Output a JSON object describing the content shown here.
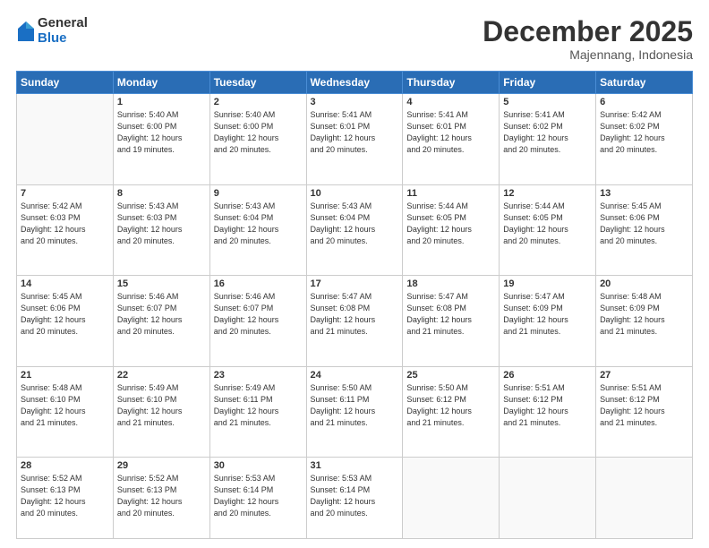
{
  "logo": {
    "general": "General",
    "blue": "Blue"
  },
  "header": {
    "month": "December 2025",
    "location": "Majennang, Indonesia"
  },
  "weekdays": [
    "Sunday",
    "Monday",
    "Tuesday",
    "Wednesday",
    "Thursday",
    "Friday",
    "Saturday"
  ],
  "weeks": [
    [
      {
        "day": "",
        "info": ""
      },
      {
        "day": "1",
        "info": "Sunrise: 5:40 AM\nSunset: 6:00 PM\nDaylight: 12 hours\nand 19 minutes."
      },
      {
        "day": "2",
        "info": "Sunrise: 5:40 AM\nSunset: 6:00 PM\nDaylight: 12 hours\nand 20 minutes."
      },
      {
        "day": "3",
        "info": "Sunrise: 5:41 AM\nSunset: 6:01 PM\nDaylight: 12 hours\nand 20 minutes."
      },
      {
        "day": "4",
        "info": "Sunrise: 5:41 AM\nSunset: 6:01 PM\nDaylight: 12 hours\nand 20 minutes."
      },
      {
        "day": "5",
        "info": "Sunrise: 5:41 AM\nSunset: 6:02 PM\nDaylight: 12 hours\nand 20 minutes."
      },
      {
        "day": "6",
        "info": "Sunrise: 5:42 AM\nSunset: 6:02 PM\nDaylight: 12 hours\nand 20 minutes."
      }
    ],
    [
      {
        "day": "7",
        "info": "Sunrise: 5:42 AM\nSunset: 6:03 PM\nDaylight: 12 hours\nand 20 minutes."
      },
      {
        "day": "8",
        "info": "Sunrise: 5:43 AM\nSunset: 6:03 PM\nDaylight: 12 hours\nand 20 minutes."
      },
      {
        "day": "9",
        "info": "Sunrise: 5:43 AM\nSunset: 6:04 PM\nDaylight: 12 hours\nand 20 minutes."
      },
      {
        "day": "10",
        "info": "Sunrise: 5:43 AM\nSunset: 6:04 PM\nDaylight: 12 hours\nand 20 minutes."
      },
      {
        "day": "11",
        "info": "Sunrise: 5:44 AM\nSunset: 6:05 PM\nDaylight: 12 hours\nand 20 minutes."
      },
      {
        "day": "12",
        "info": "Sunrise: 5:44 AM\nSunset: 6:05 PM\nDaylight: 12 hours\nand 20 minutes."
      },
      {
        "day": "13",
        "info": "Sunrise: 5:45 AM\nSunset: 6:06 PM\nDaylight: 12 hours\nand 20 minutes."
      }
    ],
    [
      {
        "day": "14",
        "info": "Sunrise: 5:45 AM\nSunset: 6:06 PM\nDaylight: 12 hours\nand 20 minutes."
      },
      {
        "day": "15",
        "info": "Sunrise: 5:46 AM\nSunset: 6:07 PM\nDaylight: 12 hours\nand 20 minutes."
      },
      {
        "day": "16",
        "info": "Sunrise: 5:46 AM\nSunset: 6:07 PM\nDaylight: 12 hours\nand 20 minutes."
      },
      {
        "day": "17",
        "info": "Sunrise: 5:47 AM\nSunset: 6:08 PM\nDaylight: 12 hours\nand 21 minutes."
      },
      {
        "day": "18",
        "info": "Sunrise: 5:47 AM\nSunset: 6:08 PM\nDaylight: 12 hours\nand 21 minutes."
      },
      {
        "day": "19",
        "info": "Sunrise: 5:47 AM\nSunset: 6:09 PM\nDaylight: 12 hours\nand 21 minutes."
      },
      {
        "day": "20",
        "info": "Sunrise: 5:48 AM\nSunset: 6:09 PM\nDaylight: 12 hours\nand 21 minutes."
      }
    ],
    [
      {
        "day": "21",
        "info": "Sunrise: 5:48 AM\nSunset: 6:10 PM\nDaylight: 12 hours\nand 21 minutes."
      },
      {
        "day": "22",
        "info": "Sunrise: 5:49 AM\nSunset: 6:10 PM\nDaylight: 12 hours\nand 21 minutes."
      },
      {
        "day": "23",
        "info": "Sunrise: 5:49 AM\nSunset: 6:11 PM\nDaylight: 12 hours\nand 21 minutes."
      },
      {
        "day": "24",
        "info": "Sunrise: 5:50 AM\nSunset: 6:11 PM\nDaylight: 12 hours\nand 21 minutes."
      },
      {
        "day": "25",
        "info": "Sunrise: 5:50 AM\nSunset: 6:12 PM\nDaylight: 12 hours\nand 21 minutes."
      },
      {
        "day": "26",
        "info": "Sunrise: 5:51 AM\nSunset: 6:12 PM\nDaylight: 12 hours\nand 21 minutes."
      },
      {
        "day": "27",
        "info": "Sunrise: 5:51 AM\nSunset: 6:12 PM\nDaylight: 12 hours\nand 21 minutes."
      }
    ],
    [
      {
        "day": "28",
        "info": "Sunrise: 5:52 AM\nSunset: 6:13 PM\nDaylight: 12 hours\nand 20 minutes."
      },
      {
        "day": "29",
        "info": "Sunrise: 5:52 AM\nSunset: 6:13 PM\nDaylight: 12 hours\nand 20 minutes."
      },
      {
        "day": "30",
        "info": "Sunrise: 5:53 AM\nSunset: 6:14 PM\nDaylight: 12 hours\nand 20 minutes."
      },
      {
        "day": "31",
        "info": "Sunrise: 5:53 AM\nSunset: 6:14 PM\nDaylight: 12 hours\nand 20 minutes."
      },
      {
        "day": "",
        "info": ""
      },
      {
        "day": "",
        "info": ""
      },
      {
        "day": "",
        "info": ""
      }
    ]
  ]
}
